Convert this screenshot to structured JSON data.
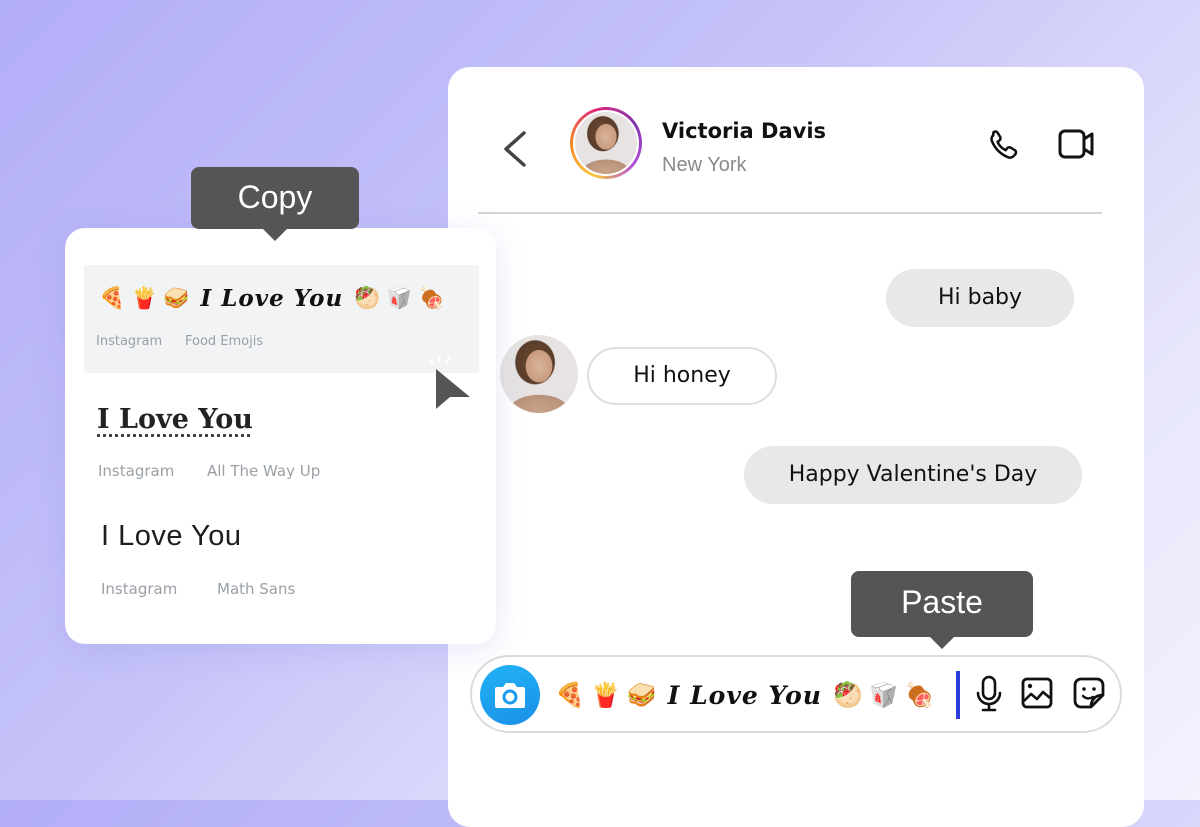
{
  "chat": {
    "contact_name": "Victoria Davis",
    "contact_location": "New York",
    "icons": {
      "back": "chevron-left-icon",
      "call": "phone-icon",
      "video": "video-camera-icon"
    },
    "messages": [
      {
        "direction": "sent",
        "text": "Hi baby"
      },
      {
        "direction": "received",
        "text": "Hi honey"
      },
      {
        "direction": "sent",
        "text": "Happy Valentine's Day"
      }
    ],
    "composer": {
      "emojis_before": [
        "🍕",
        "🍟",
        "🥪"
      ],
      "fancy_text": "I Love You",
      "emojis_after": [
        "🥙",
        "🥡",
        "🍖"
      ],
      "paste_tooltip": "Paste",
      "icons": [
        "camera-icon",
        "microphone-icon",
        "image-icon",
        "sticker-icon"
      ]
    },
    "colors": {
      "camera_button": "#1a9bee",
      "caret": "#2b3fd8",
      "tooltip": "#555555",
      "sent_bubble": "#e8e8e8"
    }
  },
  "font_card": {
    "copy_tooltip": "Copy",
    "items": [
      {
        "emojis_before": [
          "🍕",
          "🍟",
          "🥪"
        ],
        "text": "I Love You",
        "emojis_after": [
          "🥙",
          "🥡",
          "🍖"
        ],
        "platform": "Instagram",
        "style": "Food Emojis",
        "selected": true
      },
      {
        "text": "I Love You",
        "platform": "Instagram",
        "style": "All The Way Up",
        "selected": false
      },
      {
        "text": "I Love You",
        "platform": "Instagram",
        "style": "Math Sans",
        "selected": false
      }
    ]
  }
}
